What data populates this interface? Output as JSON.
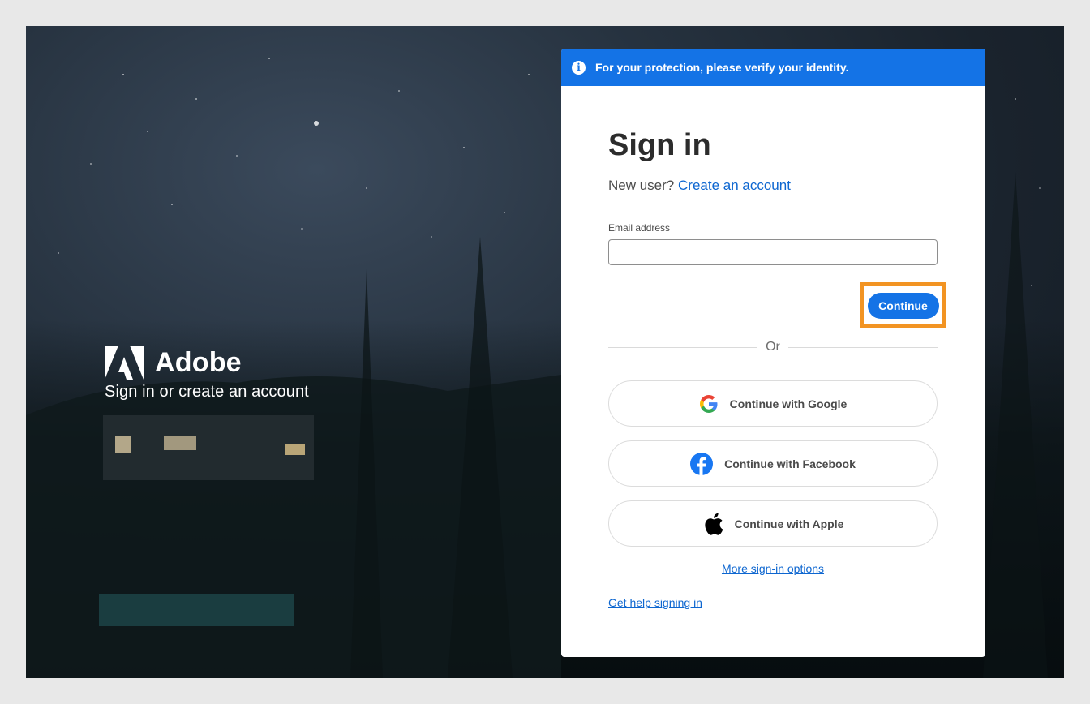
{
  "brand": {
    "name": "Adobe",
    "tagline": "Sign in or create an account"
  },
  "banner": {
    "text": "For your protection, please verify your identity."
  },
  "signin": {
    "title": "Sign in",
    "new_user_prefix": "New user?",
    "create_account_link": "Create an account",
    "email_label": "Email address",
    "email_value": "",
    "email_placeholder": "",
    "continue_label": "Continue",
    "or_text": "Or"
  },
  "social": {
    "google_label": "Continue with Google",
    "facebook_label": "Continue with Facebook",
    "apple_label": "Continue with Apple"
  },
  "links": {
    "more_options": "More sign-in options",
    "help": "Get help signing in"
  },
  "colors": {
    "accent": "#1473e6",
    "highlight_border": "#f29423",
    "link": "#0d66d0"
  }
}
